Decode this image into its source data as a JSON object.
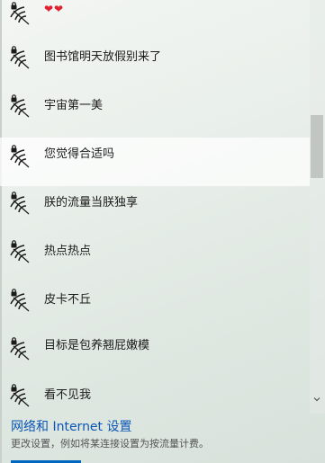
{
  "networks": [
    {
      "name": "❤❤",
      "type": "hearts"
    },
    {
      "name": "图书馆明天放假别来了"
    },
    {
      "name": "宇宙第一美"
    },
    {
      "name": "您觉得合适吗",
      "selected": true
    },
    {
      "name": "朕的流量当朕独享"
    },
    {
      "name": "热点热点"
    },
    {
      "name": "皮卡不丘"
    },
    {
      "name": "目标是包养翘屁嫩模"
    },
    {
      "name": "看不见我"
    }
  ],
  "footer": {
    "settings_link": "网络和 Internet 设置",
    "settings_desc": "更改设置，例如将某连接设置为按流量计费。"
  },
  "icons": {
    "network": "secured-wifi-icon",
    "scroll_down": "chevron-down-icon"
  },
  "colors": {
    "link": "#0a56b5",
    "hearts": "#e02030",
    "accent": "#0067c0"
  }
}
